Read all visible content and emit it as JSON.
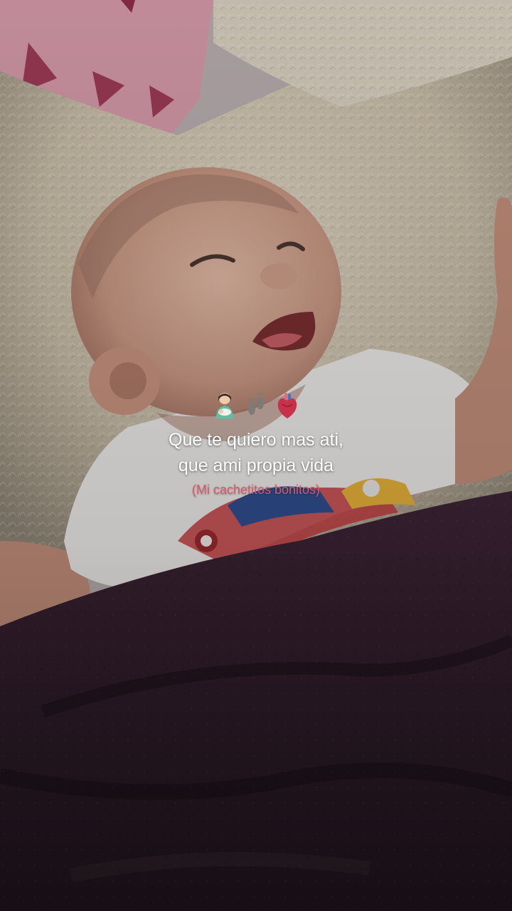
{
  "caption": {
    "emojis": [
      "mother-holding-baby-icon",
      "footprints-icon",
      "anatomical-heart-icon"
    ],
    "line1": "Que te quiero mas ati,",
    "line2": "que ami propia vida",
    "subline": "(Mi cachetitos bonitos)"
  },
  "colors": {
    "caption_text": "#ffffff",
    "subline_text": "#e0566a",
    "blanket": "#3b2434",
    "fur_pillow": "#cfc3ae",
    "onesie": "#f2f0ee"
  }
}
